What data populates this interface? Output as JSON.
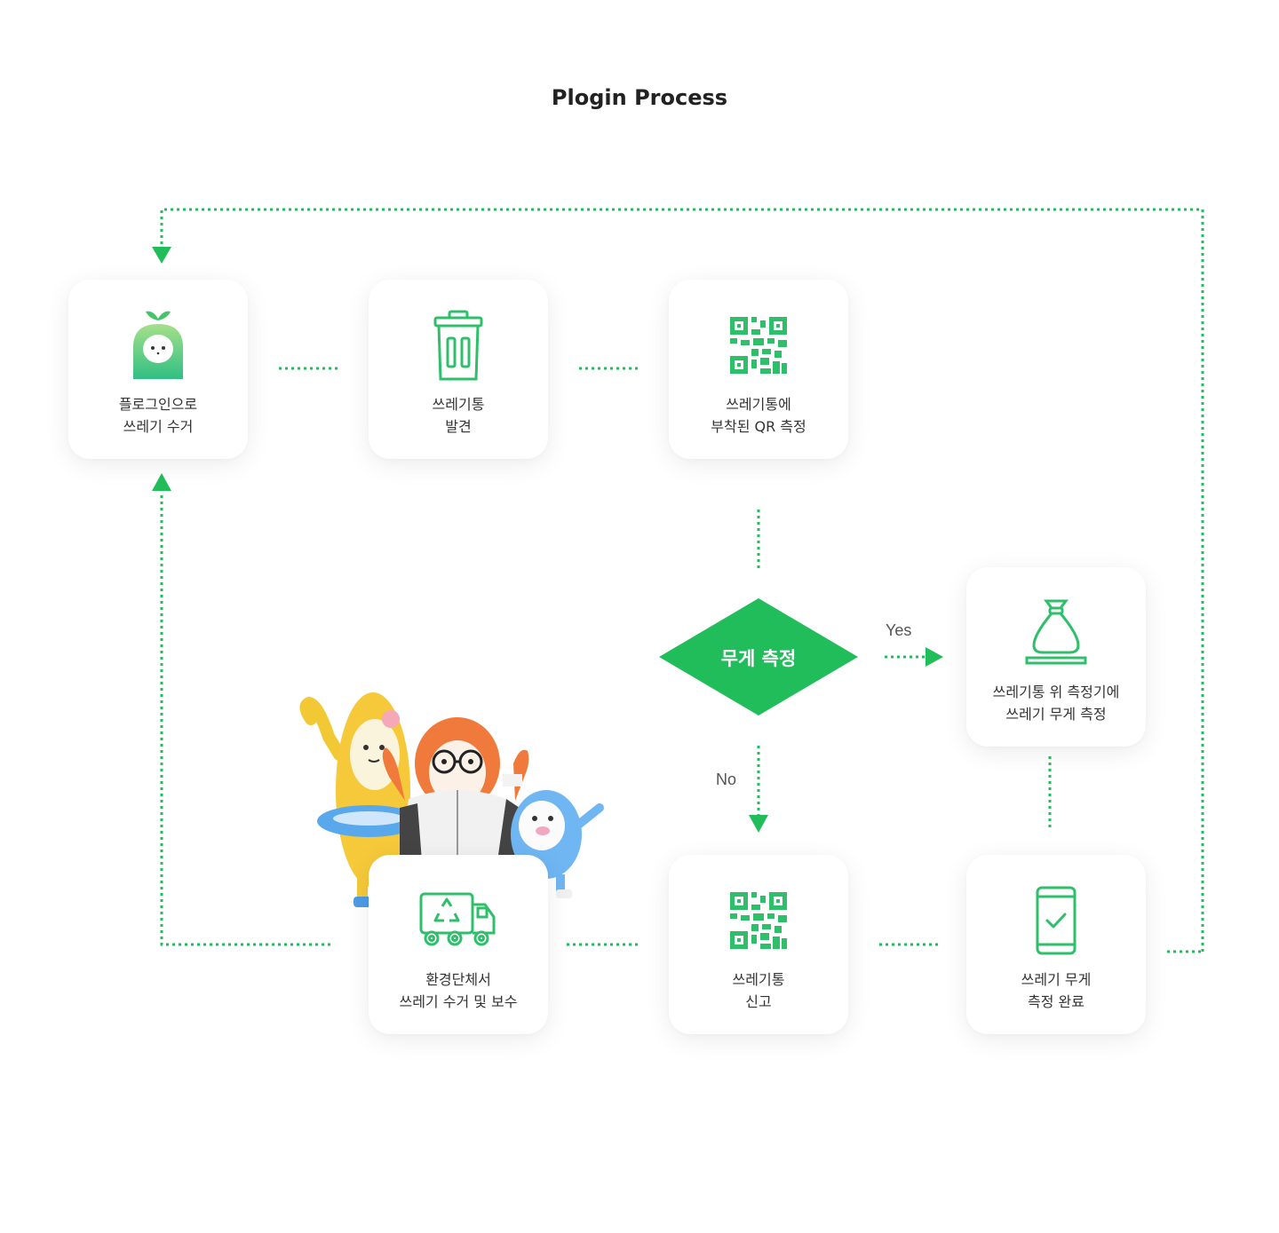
{
  "title": "Plogin Process",
  "colors": {
    "accent": "#22bd5b",
    "card_bg": "#ffffff"
  },
  "nodes": {
    "plogging": {
      "line1": "플로그인으로",
      "line2": "쓰레기 수거",
      "icon": "plogin-mascot-icon"
    },
    "find_bin": {
      "line1": "쓰레기통",
      "line2": "발견",
      "icon": "trash-bin-icon"
    },
    "scan_qr": {
      "line1": "쓰레기통에",
      "line2": "부착된 QR 측정",
      "icon": "qr-code-icon"
    },
    "measure_on_scale": {
      "line1": "쓰레기통 위 측정기에",
      "line2": "쓰레기 무게 측정",
      "icon": "garbage-bag-on-scale-icon"
    },
    "weigh_complete": {
      "line1": "쓰레기 무게",
      "line2": "측정 완료",
      "icon": "phone-check-icon"
    },
    "report_bin": {
      "line1": "쓰레기통",
      "line2": "신고",
      "icon": "qr-code-icon"
    },
    "collection": {
      "line1": "환경단체서",
      "line2": "쓰레기 수거 및 보수",
      "icon": "recycling-truck-icon"
    }
  },
  "decision": {
    "label": "무게 측정",
    "yes": "Yes",
    "no": "No"
  }
}
